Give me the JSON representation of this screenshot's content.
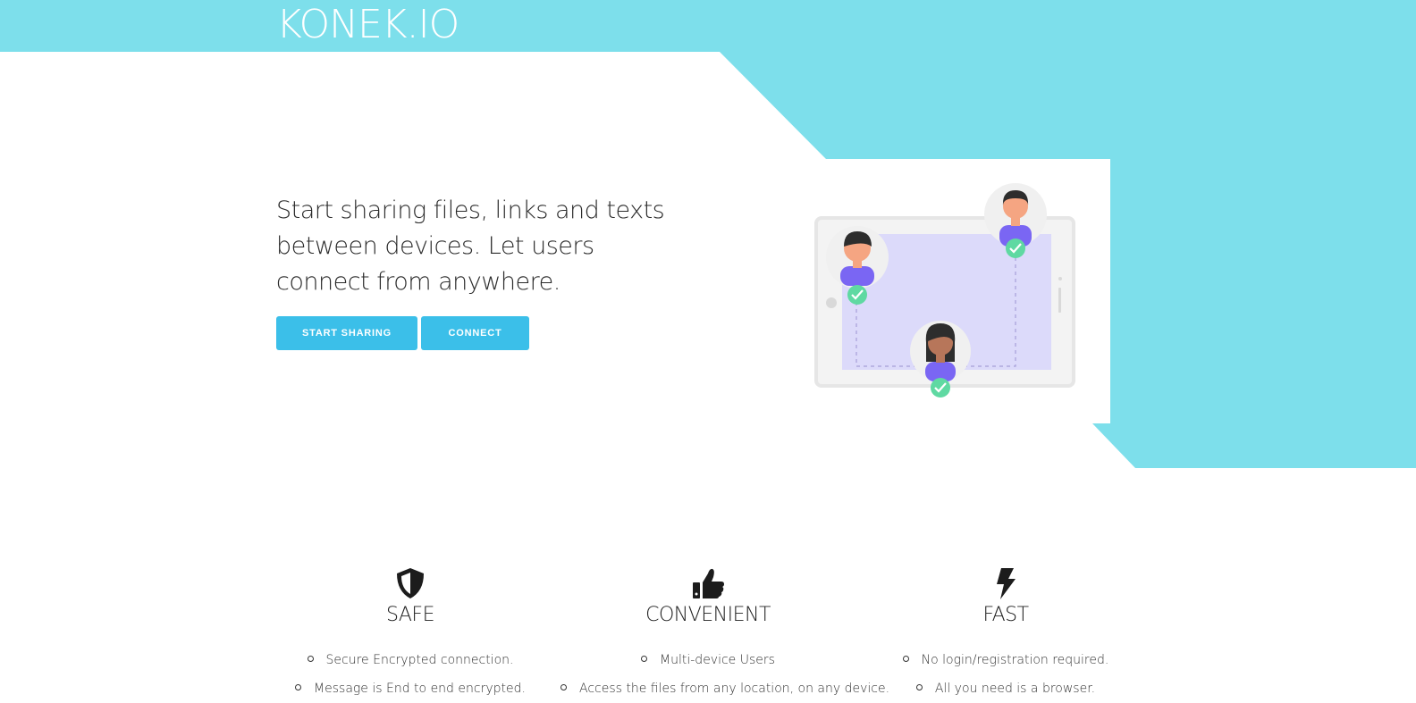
{
  "brand": {
    "logo": "KONEK.IO"
  },
  "colors": {
    "accent": "#7ddfeb",
    "button": "#3bbfe9",
    "screen": "#dcdafa",
    "avatar_shirt": "#7a66f3",
    "check": "#5fd9a2"
  },
  "hero": {
    "headline": "Start sharing files, links and texts between devices. Let users connect from anywhere.",
    "start_sharing_label": "START SHARING",
    "connect_label": "CONNECT"
  },
  "features": [
    {
      "icon": "shield-icon",
      "title": "SAFE",
      "items": [
        "Secure Encrypted connection.",
        "Message is End to end encrypted."
      ]
    },
    {
      "icon": "thumbs-up-icon",
      "title": "CONVENIENT",
      "items": [
        "Multi-device Users",
        "Access the files from any location, on any device."
      ]
    },
    {
      "icon": "lightning-icon",
      "title": "FAST",
      "items": [
        "No login/registration required.",
        "All you need is a browser."
      ]
    }
  ]
}
